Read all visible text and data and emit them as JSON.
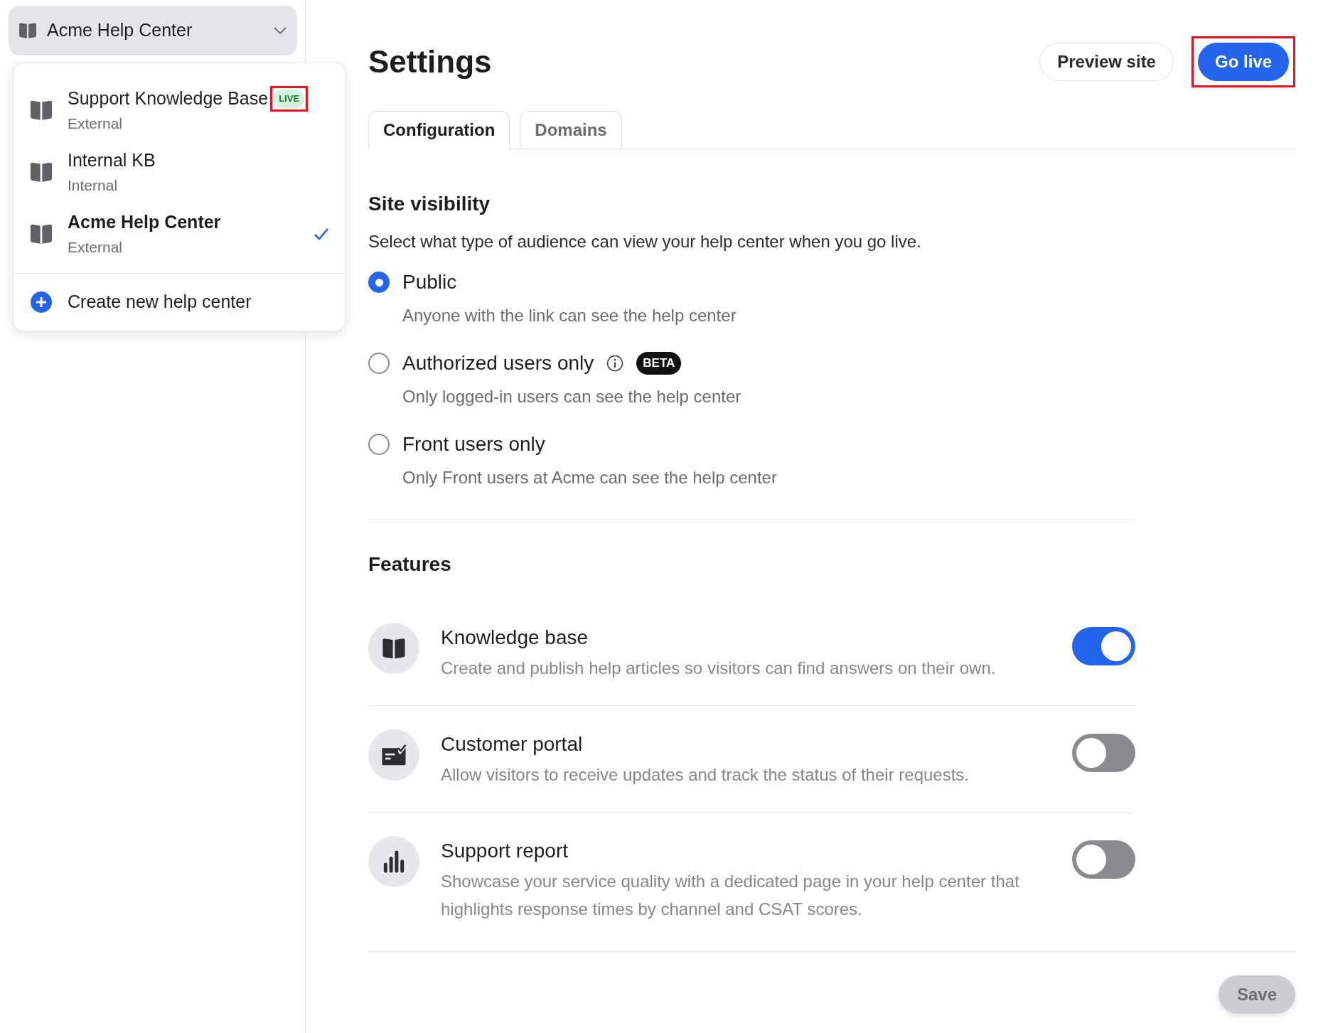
{
  "sidebar": {
    "switcher": {
      "label": "Acme Help Center"
    },
    "menu": {
      "items": [
        {
          "name": "Support Knowledge Base",
          "type": "External",
          "badge": "LIVE",
          "badge_highlighted": true,
          "selected": false
        },
        {
          "name": "Internal KB",
          "type": "Internal",
          "selected": false
        },
        {
          "name": "Acme Help Center",
          "type": "External",
          "selected": true
        }
      ],
      "create": "Create new help center"
    }
  },
  "header": {
    "title": "Settings",
    "buttons": [
      {
        "label": "Preview site",
        "kind": "secondary",
        "highlighted": false
      },
      {
        "label": "Go live",
        "kind": "primary",
        "highlighted": true
      }
    ]
  },
  "tabs": [
    {
      "label": "Configuration",
      "selected": true
    },
    {
      "label": "Domains",
      "selected": false
    }
  ],
  "site_visibility": {
    "title": "Site visibility",
    "description": "Select what type of audience can view your help center when you go live.",
    "options": [
      {
        "label": "Public",
        "description": "Anyone with the link can see the help center",
        "selected": true
      },
      {
        "label": "Authorized users only",
        "description": "Only logged-in users can see the help center",
        "selected": false,
        "info": true,
        "badge": "BETA"
      },
      {
        "label": "Front users only",
        "description": "Only Front users at Acme can see the help center",
        "selected": false
      }
    ]
  },
  "features": {
    "title": "Features",
    "items": [
      {
        "kind": "book",
        "title": "Knowledge base",
        "description": "Create and publish help articles so visitors can find answers on their own.",
        "on": true
      },
      {
        "kind": "portal",
        "title": "Customer portal",
        "description": "Allow visitors to receive updates and track the status of their requests.",
        "on": false
      },
      {
        "kind": "chart",
        "title": "Support report",
        "description": "Showcase your service quality with a dedicated page in your help center that highlights response times by channel and CSAT scores.",
        "on": false
      }
    ]
  },
  "save_button": {
    "label": "Save",
    "disabled": true
  }
}
